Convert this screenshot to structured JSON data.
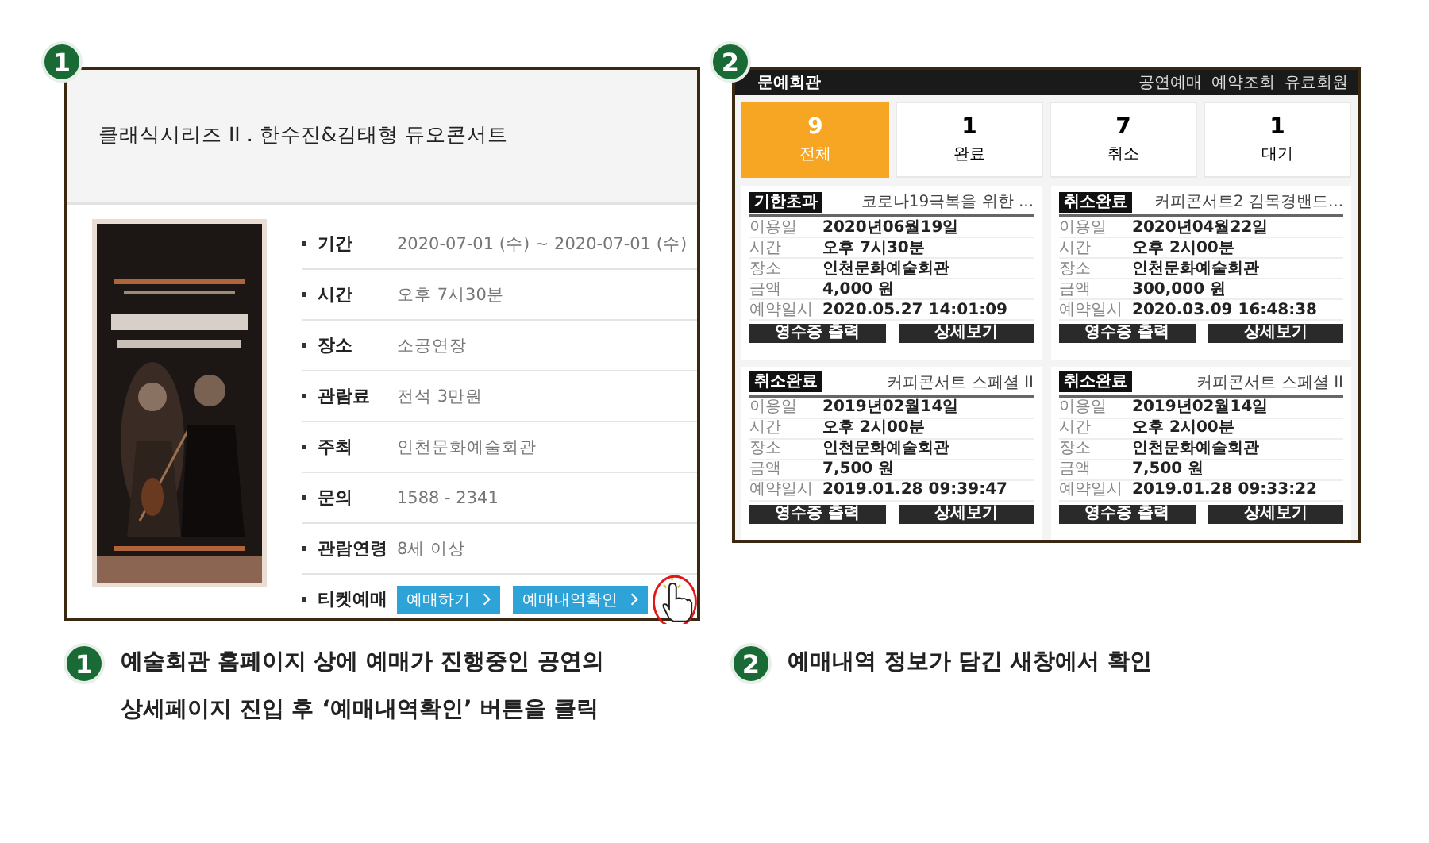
{
  "detail_page": {
    "badge": "1",
    "title": "클래식시리즈 II . 한수진&김태형 듀오콘서트",
    "info": [
      {
        "label": "기간",
        "value": "2020-07-01 (수) ~ 2020-07-01 (수)"
      },
      {
        "label": "시간",
        "value": "오후 7시30분"
      },
      {
        "label": "장소",
        "value": "소공연장"
      },
      {
        "label": "관람료",
        "value": "전석 3만원"
      },
      {
        "label": "주최",
        "value": "인천문화예술회관"
      },
      {
        "label": "문의",
        "value": "1588 - 2341"
      },
      {
        "label": "관람연령",
        "value": "8세 이상"
      }
    ],
    "ticket": {
      "label": "티켓예매",
      "buttons": [
        "예매하기",
        "예매내역확인"
      ]
    }
  },
  "booking_page": {
    "badge": "2",
    "site_name": "문예회관",
    "nav": [
      "공연예매",
      "예약조회",
      "유료회원"
    ],
    "stats": [
      {
        "count": "9",
        "label": "전체",
        "selected": true
      },
      {
        "count": "1",
        "label": "완료",
        "selected": false
      },
      {
        "count": "7",
        "label": "취소",
        "selected": false
      },
      {
        "count": "1",
        "label": "대기",
        "selected": false
      }
    ],
    "cards": [
      {
        "status": "기한초과",
        "title": "코로나19극복을 위한 ...",
        "rows": [
          {
            "label": "이용일",
            "value": "2020년06월19일"
          },
          {
            "label": "시간",
            "value": "오후 7시30분"
          },
          {
            "label": "장소",
            "value": "인천문화예술회관"
          },
          {
            "label": "금액",
            "value": "4,000 원"
          },
          {
            "label": "예약일시",
            "value": "2020.05.27 14:01:09"
          }
        ],
        "buttons": [
          "영수증 출력",
          "상세보기"
        ]
      },
      {
        "status": "취소완료",
        "title": "커피콘서트2 김목경밴드...",
        "rows": [
          {
            "label": "이용일",
            "value": "2020년04월22일"
          },
          {
            "label": "시간",
            "value": "오후 2시00분"
          },
          {
            "label": "장소",
            "value": "인천문화예술회관"
          },
          {
            "label": "금액",
            "value": "300,000 원"
          },
          {
            "label": "예약일시",
            "value": "2020.03.09 16:48:38"
          }
        ],
        "buttons": [
          "영수증 출력",
          "상세보기"
        ]
      },
      {
        "status": "취소완료",
        "title": "커피콘서트 스페셜 II",
        "rows": [
          {
            "label": "이용일",
            "value": "2019년02월14일"
          },
          {
            "label": "시간",
            "value": "오후 2시00분"
          },
          {
            "label": "장소",
            "value": "인천문화예술회관"
          },
          {
            "label": "금액",
            "value": "7,500 원"
          },
          {
            "label": "예약일시",
            "value": "2019.01.28 09:39:47"
          }
        ],
        "buttons": [
          "영수증 출력",
          "상세보기"
        ]
      },
      {
        "status": "취소완료",
        "title": "커피콘서트 스페셜 II",
        "rows": [
          {
            "label": "이용일",
            "value": "2019년02월14일"
          },
          {
            "label": "시간",
            "value": "오후 2시00분"
          },
          {
            "label": "장소",
            "value": "인천문화예술회관"
          },
          {
            "label": "금액",
            "value": "7,500 원"
          },
          {
            "label": "예약일시",
            "value": "2019.01.28 09:33:22"
          }
        ],
        "buttons": [
          "영수증 출력",
          "상세보기"
        ]
      }
    ]
  },
  "captions": [
    {
      "badge": "1",
      "lines": [
        "예술회관 홈페이지 상에 예매가 진행중인 공연의",
        "상세페이지 진입 후 ‘예매내역확인’ 버튼을 클릭"
      ]
    },
    {
      "badge": "2",
      "lines": [
        "예매내역 정보가 담긴 새창에서 확인"
      ]
    }
  ]
}
